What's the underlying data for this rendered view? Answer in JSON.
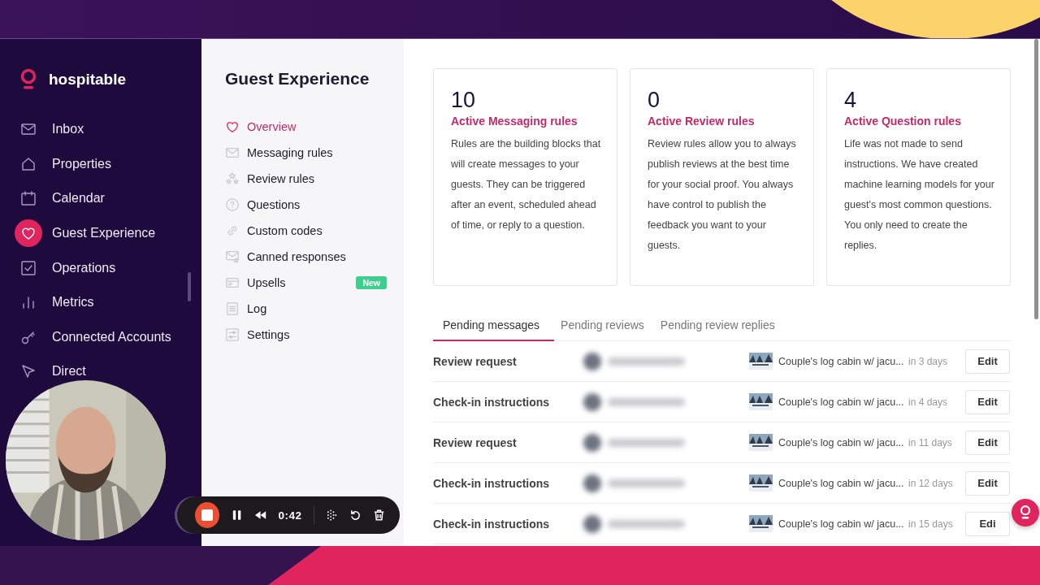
{
  "brand": {
    "name": "hospitable"
  },
  "sidebar": {
    "items": [
      {
        "label": "Inbox",
        "selected": false
      },
      {
        "label": "Properties",
        "selected": false
      },
      {
        "label": "Calendar",
        "selected": false
      },
      {
        "label": "Guest Experience",
        "selected": true
      },
      {
        "label": "Operations",
        "selected": false
      },
      {
        "label": "Metrics",
        "selected": false
      },
      {
        "label": "Connected Accounts",
        "selected": false
      },
      {
        "label": "Direct",
        "selected": false
      }
    ]
  },
  "subnav": {
    "title": "Guest Experience",
    "items": [
      {
        "label": "Overview",
        "selected": true
      },
      {
        "label": "Messaging rules",
        "selected": false
      },
      {
        "label": "Review rules",
        "selected": false
      },
      {
        "label": "Questions",
        "selected": false
      },
      {
        "label": "Custom codes",
        "selected": false
      },
      {
        "label": "Canned responses",
        "selected": false
      },
      {
        "label": "Upsells",
        "selected": false,
        "badge": "New"
      },
      {
        "label": "Log",
        "selected": false
      },
      {
        "label": "Settings",
        "selected": false
      }
    ]
  },
  "cards": [
    {
      "count": "10",
      "title": "Active Messaging rules",
      "text": "Rules are the building blocks that will create messages to your guests. They can be triggered after an event, scheduled ahead of time, or reply to a question."
    },
    {
      "count": "0",
      "title": "Active Review rules",
      "text": "Review rules allow you to always publish reviews at the best time for your social proof. You always have control to publish the feedback you want to your guests."
    },
    {
      "count": "4",
      "title": "Active Question rules",
      "text": "Life was not made to send instructions. We have created machine learning models for your guest's most common questions. You only need to create the replies."
    }
  ],
  "tabs": [
    {
      "label": "Pending messages",
      "selected": true
    },
    {
      "label": "Pending reviews",
      "selected": false
    },
    {
      "label": "Pending review replies",
      "selected": false
    }
  ],
  "rows": [
    {
      "type": "Review request",
      "property": "Couple's log cabin w/ jacu...",
      "due": "in 3 days",
      "action": "Edit"
    },
    {
      "type": "Check-in instructions",
      "property": "Couple's log cabin w/ jacu...",
      "due": "in 4 days",
      "action": "Edit"
    },
    {
      "type": "Review request",
      "property": "Couple's log cabin w/ jacu...",
      "due": "in 11 days",
      "action": "Edit"
    },
    {
      "type": "Check-in instructions",
      "property": "Couple's log cabin w/ jacu...",
      "due": "in 12 days",
      "action": "Edit"
    },
    {
      "type": "Check-in instructions",
      "property": "Couple's log cabin w/ jacu...",
      "due": "in 15 days",
      "action": "Edi"
    }
  ],
  "recorder": {
    "time": "0:42"
  }
}
